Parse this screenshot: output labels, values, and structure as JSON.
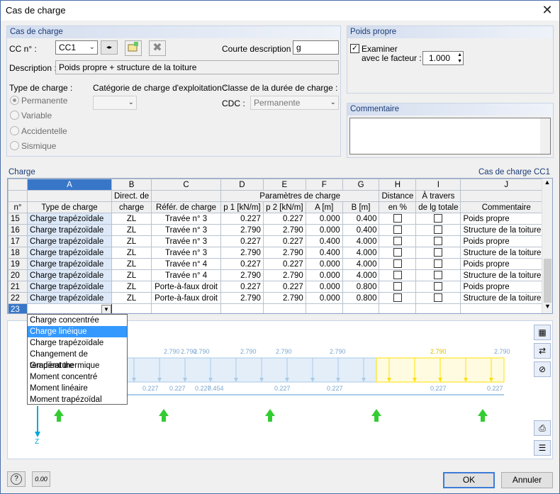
{
  "window": {
    "title": "Cas de charge"
  },
  "cas_de_charge": {
    "header": "Cas de charge",
    "cc_label": "CC n° :",
    "cc_value": "CC1",
    "courte_label": "Courte description :",
    "courte_value": "g",
    "description_label": "Description :",
    "description_value": "Poids propre + structure de la toiture",
    "type_label": "Type de charge :",
    "types": [
      "Permanente",
      "Variable",
      "Accidentelle",
      "Sismique"
    ],
    "categorie_label": "Catégorie de charge d'exploitation :",
    "classe_label": "Classe de la durée de charge :",
    "cdc_label": "CDC :",
    "cdc_value": "Permanente"
  },
  "poids_propre": {
    "header": "Poids propre",
    "examiner_label": "Examiner",
    "facteur_label": "avec le facteur :",
    "facteur_value": "1.000"
  },
  "commentaire": {
    "header": "Commentaire"
  },
  "charge": {
    "header": "Charge",
    "case_label": "Cas de charge CC1",
    "col_letters": [
      "A",
      "B",
      "C",
      "D",
      "E",
      "F",
      "G",
      "H",
      "I",
      "J"
    ],
    "hdr_row1": {
      "b": "Direct. de",
      "params": "Paramètres de charge",
      "h": "Distance",
      "i": "À travers"
    },
    "hdr_row2": {
      "n": "n°",
      "a": "Type de charge",
      "b": "charge",
      "c": "Référ. de charge",
      "d": "p 1 [kN/m]",
      "e": "p 2 [kN/m]",
      "f": "A [m]",
      "g": "B [m]",
      "h": "en %",
      "i": "de lg totale",
      "j": "Commentaire"
    },
    "rows": [
      {
        "n": "15",
        "type": "Charge trapézoïdale",
        "dir": "ZL",
        "ref": "Travée n° 3",
        "p1": "0.227",
        "p2": "0.227",
        "a": "0.000",
        "b": "0.400",
        "com": "Poids propre"
      },
      {
        "n": "16",
        "type": "Charge trapézoïdale",
        "dir": "ZL",
        "ref": "Travée n° 3",
        "p1": "2.790",
        "p2": "2.790",
        "a": "0.000",
        "b": "0.400",
        "com": "Structure de la toiture"
      },
      {
        "n": "17",
        "type": "Charge trapézoïdale",
        "dir": "ZL",
        "ref": "Travée n° 3",
        "p1": "0.227",
        "p2": "0.227",
        "a": "0.400",
        "b": "4.000",
        "com": "Poids propre"
      },
      {
        "n": "18",
        "type": "Charge trapézoïdale",
        "dir": "ZL",
        "ref": "Travée n° 3",
        "p1": "2.790",
        "p2": "2.790",
        "a": "0.400",
        "b": "4.000",
        "com": "Structure de la toiture"
      },
      {
        "n": "19",
        "type": "Charge trapézoïdale",
        "dir": "ZL",
        "ref": "Travée n° 4",
        "p1": "0.227",
        "p2": "0.227",
        "a": "0.000",
        "b": "4.000",
        "com": "Poids propre"
      },
      {
        "n": "20",
        "type": "Charge trapézoïdale",
        "dir": "ZL",
        "ref": "Travée n° 4",
        "p1": "2.790",
        "p2": "2.790",
        "a": "0.000",
        "b": "4.000",
        "com": "Structure de la toiture"
      },
      {
        "n": "21",
        "type": "Charge trapézoïdale",
        "dir": "ZL",
        "ref": "Porte-à-faux droit",
        "p1": "0.227",
        "p2": "0.227",
        "a": "0.000",
        "b": "0.800",
        "com": "Poids propre"
      },
      {
        "n": "22",
        "type": "Charge trapézoïdale",
        "dir": "ZL",
        "ref": "Porte-à-faux droit",
        "p1": "2.790",
        "p2": "2.790",
        "a": "0.000",
        "b": "0.800",
        "com": "Structure de la toiture"
      }
    ],
    "new_row": "23",
    "dropdown": [
      "Charge concentrée",
      "Charge linéique",
      "Charge trapézoïdale",
      "Changement de température",
      "Gradient thermique",
      "Moment concentré",
      "Moment linéaire",
      "Moment trapézoïdal"
    ],
    "dropdown_selected": 1
  },
  "graphic": {
    "top_labels": [
      "2.790",
      "2.790",
      "2.790",
      "2.790",
      "2.790",
      "2.790",
      "2.790",
      "2.790"
    ],
    "bottom_labels": [
      "0.227",
      "0.227",
      "0.227",
      "0.454",
      "0.227",
      "0.227",
      "0.227",
      "0.227"
    ],
    "axis_label": "Z",
    "accent": "#ffe000",
    "load_color": "#a9cbe9"
  },
  "buttons": {
    "ok": "OK",
    "cancel": "Annuler",
    "zero_icon": "0.00"
  }
}
